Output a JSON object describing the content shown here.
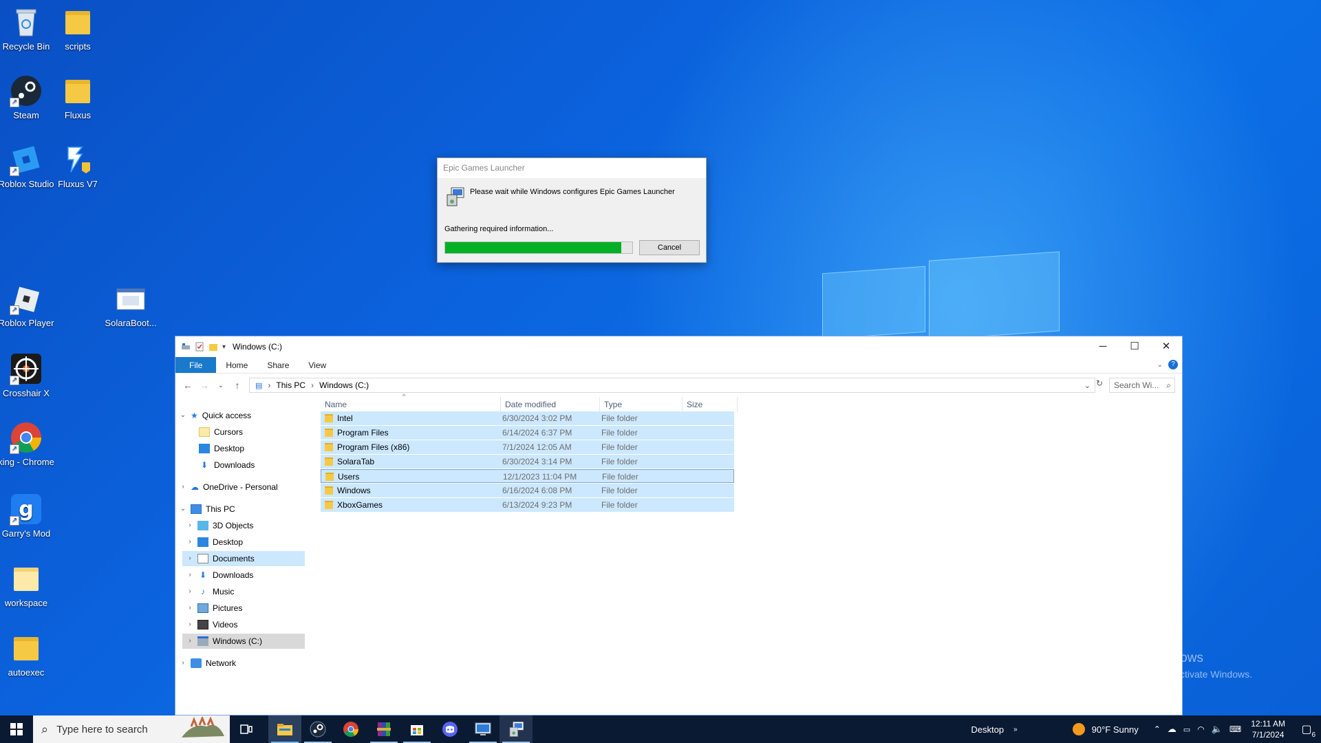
{
  "desktop": {
    "icons": [
      {
        "label": "Recycle Bin"
      },
      {
        "label": "scripts"
      },
      {
        "label": "Steam"
      },
      {
        "label": "Fluxus"
      },
      {
        "label": "Roblox Studio"
      },
      {
        "label": "Fluxus V7"
      },
      {
        "label": "Roblox Player"
      },
      {
        "label": "SolaraBoot..."
      },
      {
        "label": "Crosshair X"
      },
      {
        "label": "king - Chrome"
      },
      {
        "label": "Garry's Mod"
      },
      {
        "label": "workspace"
      },
      {
        "label": "autoexec"
      }
    ],
    "watermark": {
      "line1": "Activate Windows",
      "line2": "Go to Settings to activate Windows."
    }
  },
  "dialog": {
    "title": "Epic Games Launcher",
    "message": "Please wait while Windows configures Epic Games Launcher",
    "status": "Gathering required information...",
    "progress": 0.94,
    "cancel_label": "Cancel",
    "progress_color": "#06b025"
  },
  "explorer": {
    "title": "Windows (C:)",
    "ribbon_tabs": [
      "File",
      "Home",
      "Share",
      "View"
    ],
    "breadcrumb": [
      "This PC",
      "Windows (C:)"
    ],
    "search_placeholder": "Search Wi...",
    "nav": {
      "quick_access": "Quick access",
      "quick_items": [
        "Cursors",
        "Desktop",
        "Downloads"
      ],
      "onedrive": "OneDrive - Personal",
      "this_pc": "This PC",
      "pc_items": [
        "3D Objects",
        "Desktop",
        "Documents",
        "Downloads",
        "Music",
        "Pictures",
        "Videos",
        "Windows (C:)"
      ],
      "network": "Network"
    },
    "columns": [
      "Name",
      "Date modified",
      "Type",
      "Size"
    ],
    "rows": [
      {
        "name": "Intel",
        "date": "6/30/2024 3:02 PM",
        "type": "File folder"
      },
      {
        "name": "Program Files",
        "date": "6/14/2024 6:37 PM",
        "type": "File folder"
      },
      {
        "name": "Program Files (x86)",
        "date": "7/1/2024 12:05 AM",
        "type": "File folder"
      },
      {
        "name": "SolaraTab",
        "date": "6/30/2024 3:14 PM",
        "type": "File folder"
      },
      {
        "name": "Users",
        "date": "12/1/2023 11:04 PM",
        "type": "File folder"
      },
      {
        "name": "Windows",
        "date": "6/16/2024 6:08 PM",
        "type": "File folder"
      },
      {
        "name": "XboxGames",
        "date": "6/13/2024 9:23 PM",
        "type": "File folder"
      }
    ]
  },
  "taskbar": {
    "search_placeholder": "Type here to search",
    "desktop_label": "Desktop",
    "weather": "90°F  Sunny",
    "time": "12:11 AM",
    "date": "7/1/2024",
    "notifications": "6",
    "pinned_icons": [
      "task-view-icon",
      "file-explorer-icon",
      "steam-icon",
      "chrome-icon",
      "winrar-icon",
      "store-icon",
      "discord-icon",
      "remote-desktop-icon",
      "installer-icon"
    ]
  }
}
